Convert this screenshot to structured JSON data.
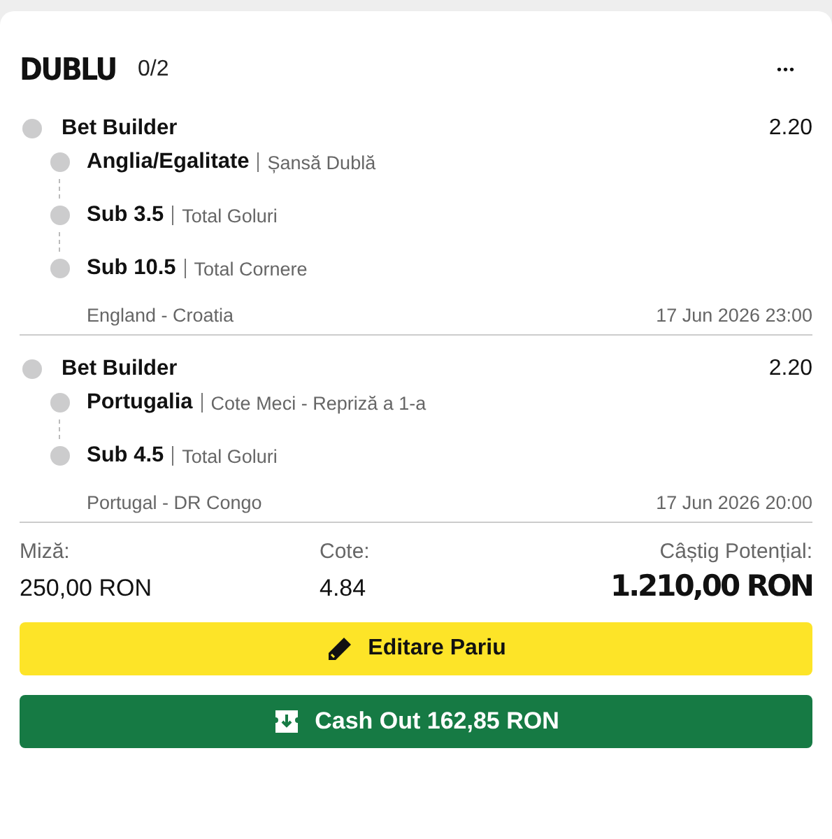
{
  "header": {
    "title": "DUBLU",
    "count": "0/2",
    "menu": "•••"
  },
  "bets": [
    {
      "name": "Bet Builder",
      "odds": "2.20",
      "selections": [
        {
          "pick": "Anglia/Egalitate",
          "market": "Șansă Dublă"
        },
        {
          "pick": "Sub 3.5",
          "market": "Total Goluri"
        },
        {
          "pick": "Sub 10.5",
          "market": "Total Cornere"
        }
      ],
      "match": "England - Croatia",
      "date": "17 Jun 2026 23:00"
    },
    {
      "name": "Bet Builder",
      "odds": "2.20",
      "selections": [
        {
          "pick": "Portugalia",
          "market": "Cote Meci - Repriză a 1-a"
        },
        {
          "pick": "Sub 4.5",
          "market": "Total Goluri"
        }
      ],
      "match": "Portugal - DR Congo",
      "date": "17 Jun 2026 20:00"
    }
  ],
  "summary": {
    "stake_label": "Miză:",
    "stake": "250,00 RON",
    "odds_label": "Cote:",
    "odds": "4.84",
    "win_label": "Câștig Potențial:",
    "win": "1.210,00 RON"
  },
  "buttons": [
    {
      "kind": "edit",
      "label": "Editare Pariu"
    },
    {
      "kind": "cashout",
      "label": "Cash Out 162,85 RON"
    }
  ]
}
